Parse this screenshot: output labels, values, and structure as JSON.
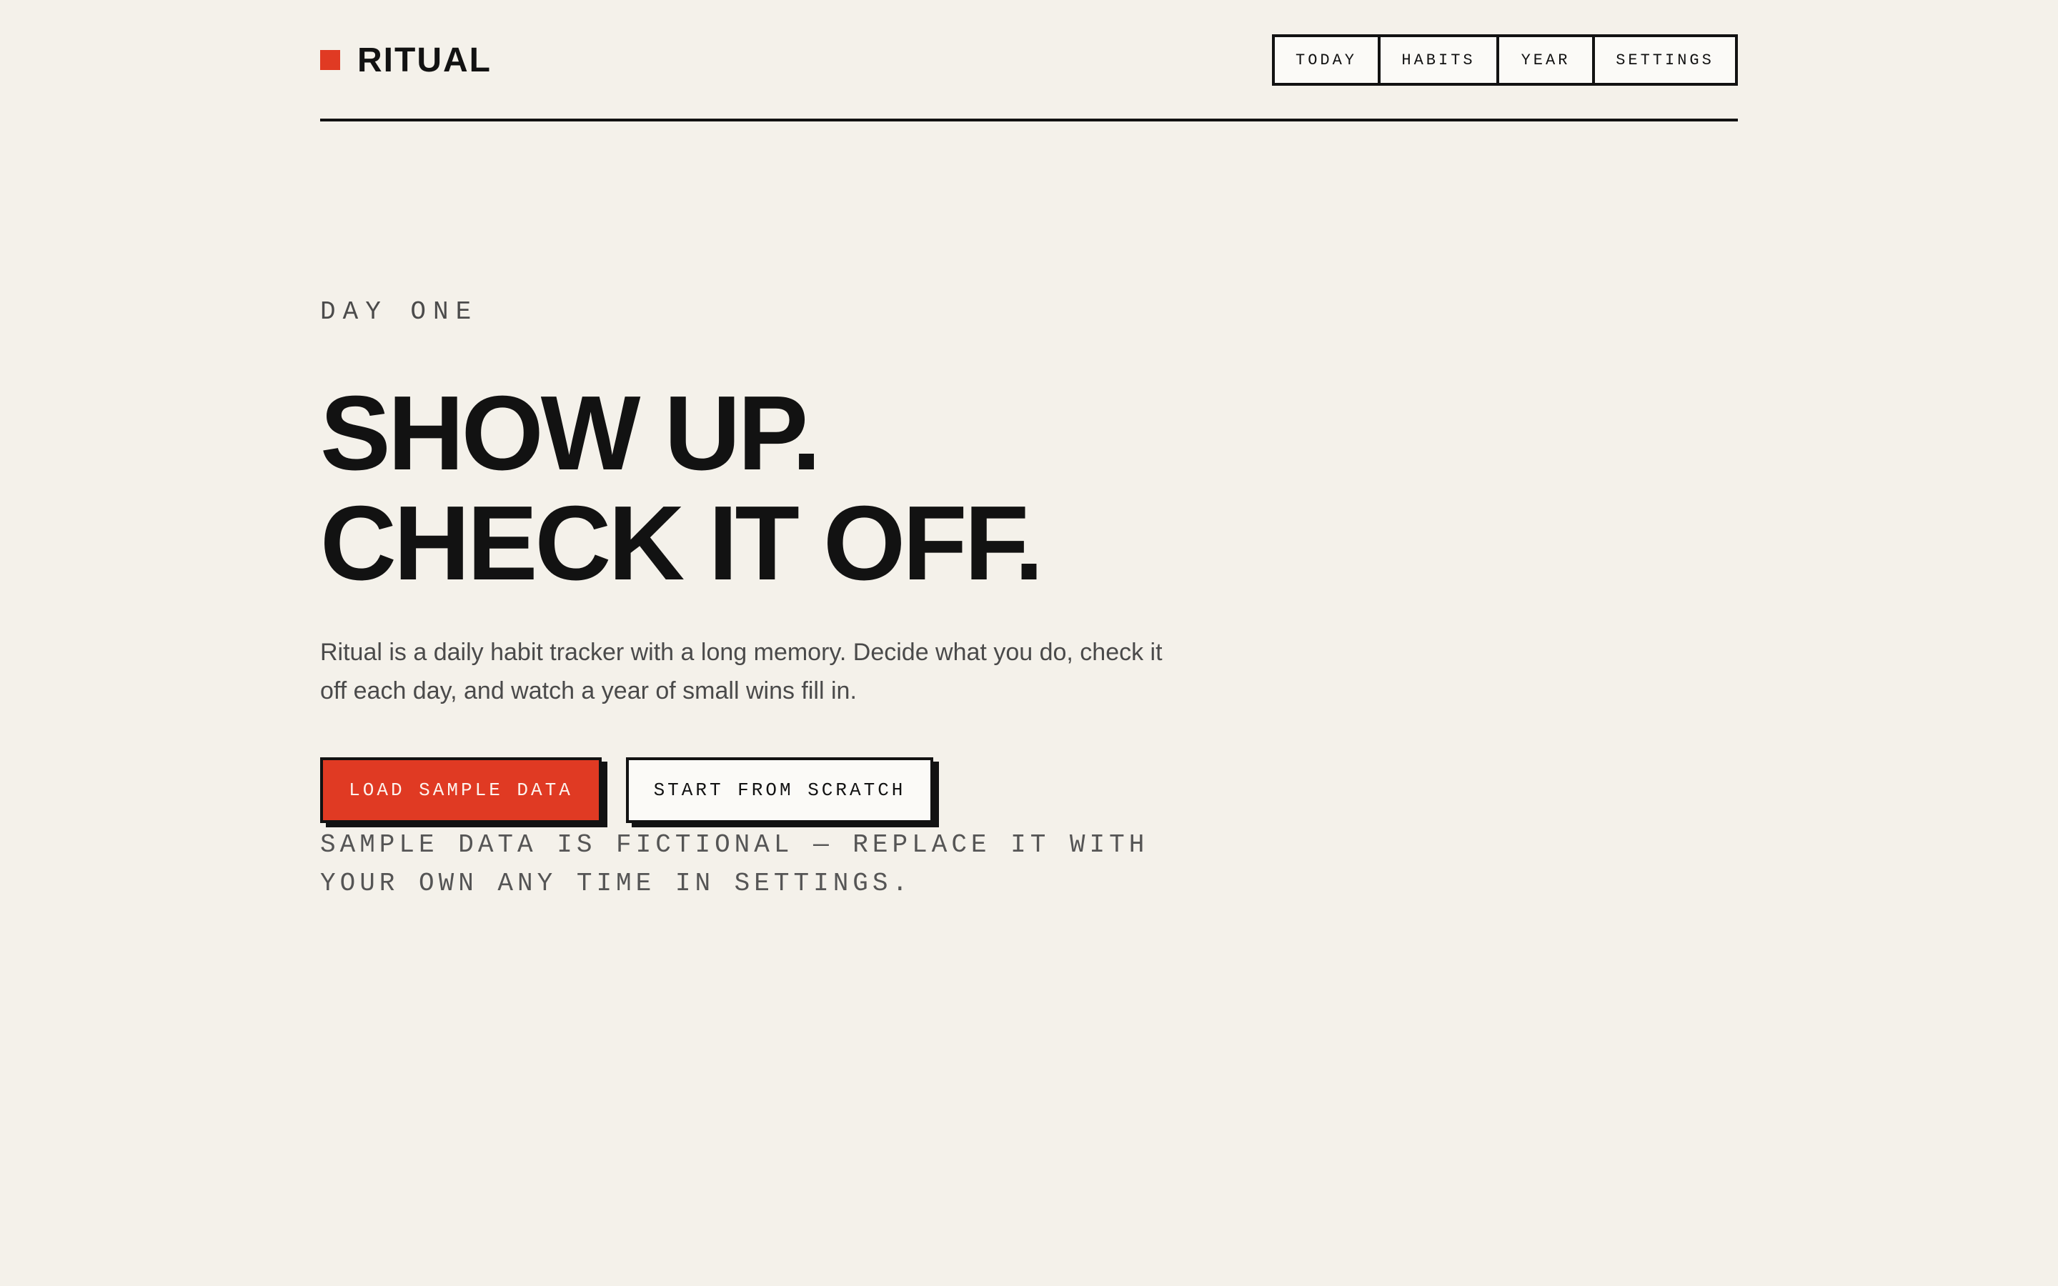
{
  "brand": {
    "name": "RITUAL",
    "accent_color": "#e03a23"
  },
  "nav": {
    "items": [
      {
        "label": "TODAY"
      },
      {
        "label": "HABITS"
      },
      {
        "label": "YEAR"
      },
      {
        "label": "SETTINGS"
      }
    ]
  },
  "hero": {
    "eyebrow": "DAY ONE",
    "headline_line1": "SHOW UP.",
    "headline_line2": "CHECK IT OFF.",
    "lede": "Ritual is a daily habit tracker with a long memory. Decide what you do, check it off each day, and watch a year of small wins fill in.",
    "primary_button": "LOAD SAMPLE DATA",
    "secondary_button": "START FROM SCRATCH",
    "note": "SAMPLE DATA IS FICTIONAL — REPLACE IT WITH YOUR OWN ANY TIME IN SETTINGS."
  },
  "colors": {
    "background": "#f4f1ea",
    "ink": "#121212",
    "accent": "#e03a23"
  }
}
